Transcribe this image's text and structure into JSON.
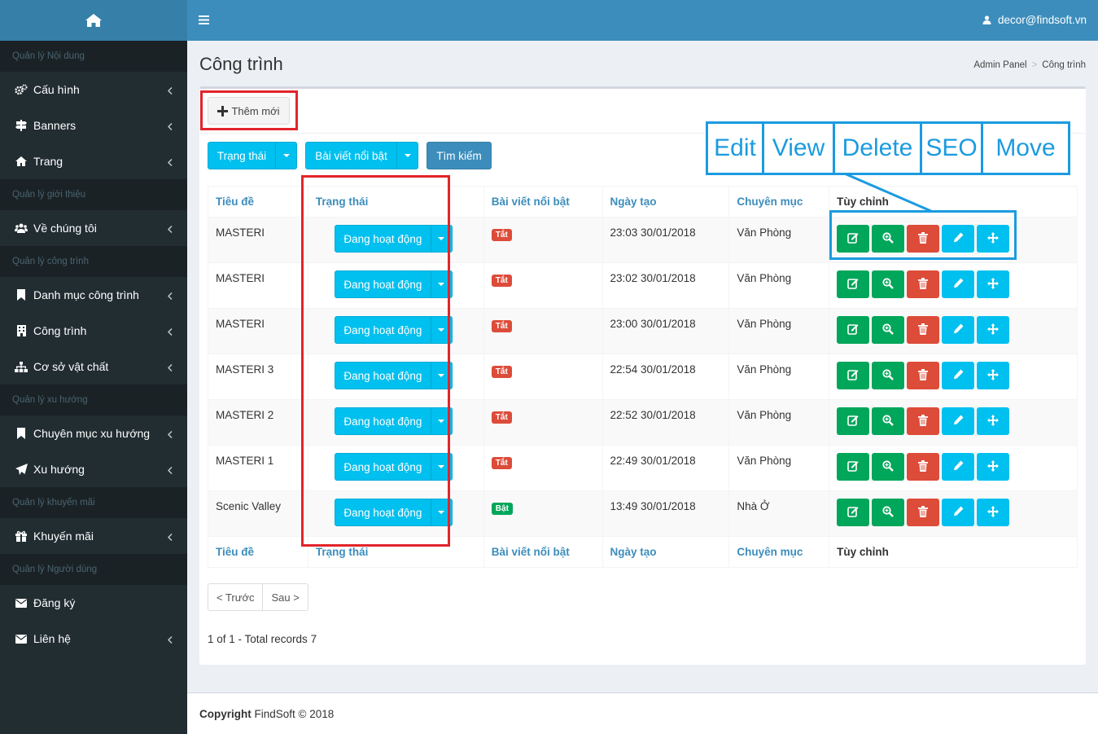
{
  "sidebar": {
    "groups": [
      {
        "title": "Quản lý Nội dung",
        "items": [
          {
            "label": "Cấu hình",
            "icon": "cogs-icon"
          },
          {
            "label": "Banners",
            "icon": "signpost-icon"
          },
          {
            "label": "Trang",
            "icon": "home-icon"
          }
        ]
      },
      {
        "title": "Quản lý giới thiệu",
        "items": [
          {
            "label": "Về chúng tôi",
            "icon": "users-icon"
          }
        ]
      },
      {
        "title": "Quản lý công trình",
        "items": [
          {
            "label": "Danh mục công trình",
            "icon": "bookmark-icon"
          },
          {
            "label": "Công trình",
            "icon": "building-icon"
          },
          {
            "label": "Cơ sở vật chất",
            "icon": "sitemap-icon"
          }
        ]
      },
      {
        "title": "Quản lý xu hướng",
        "items": [
          {
            "label": "Chuyên mục xu hướng",
            "icon": "bookmark-icon"
          },
          {
            "label": "Xu hướng",
            "icon": "paper-plane-icon"
          }
        ]
      },
      {
        "title": "Quản lý khuyến mãi",
        "items": [
          {
            "label": "Khuyến mãi",
            "icon": "gift-icon"
          }
        ]
      },
      {
        "title": "Quản lý Người dùng",
        "items": [
          {
            "label": "Đăng ký",
            "icon": "envelope-icon"
          },
          {
            "label": "Liên hệ",
            "icon": "envelope-icon"
          }
        ]
      }
    ]
  },
  "header": {
    "user": "decor@findsoft.vn"
  },
  "page": {
    "title": "Công trình",
    "breadcrumb": [
      "Admin Panel",
      "Công trình"
    ]
  },
  "toolbar": {
    "add_label": "Thêm mới",
    "status_filter": "Trạng thái",
    "featured_filter": "Bài viết nổi bật",
    "search_label": "Tìm kiếm"
  },
  "table": {
    "headers": [
      "Tiêu đề",
      "Trạng thái",
      "Bài viết nổi bật",
      "Ngày tạo",
      "Chuyên mục",
      "Tùy chỉnh"
    ],
    "rows": [
      {
        "title": "MASTERI",
        "status": "Đang hoạt động",
        "featured": "Tắt",
        "date": "23:03 30/01/2018",
        "category": "Văn Phòng"
      },
      {
        "title": "MASTERI",
        "status": "Đang hoạt động",
        "featured": "Tắt",
        "date": "23:02 30/01/2018",
        "category": "Văn Phòng"
      },
      {
        "title": "MASTERI",
        "status": "Đang hoạt động",
        "featured": "Tắt",
        "date": "23:00 30/01/2018",
        "category": "Văn Phòng"
      },
      {
        "title": "MASTERI 3",
        "status": "Đang hoạt động",
        "featured": "Tắt",
        "date": "22:54 30/01/2018",
        "category": "Văn Phòng"
      },
      {
        "title": "MASTERI 2",
        "status": "Đang hoạt động",
        "featured": "Tắt",
        "date": "22:52 30/01/2018",
        "category": "Văn Phòng"
      },
      {
        "title": "MASTERI 1",
        "status": "Đang hoạt động",
        "featured": "Tắt",
        "date": "22:49 30/01/2018",
        "category": "Văn Phòng"
      },
      {
        "title": "Scenic Valley",
        "status": "Đang hoạt động",
        "featured": "Bật",
        "date": "13:49 30/01/2018",
        "category": "Nhà Ở"
      }
    ]
  },
  "pager": {
    "prev": "< Trước",
    "next": "Sau >",
    "total": "1 of 1 - Total records 7"
  },
  "footer": {
    "bold": "Copyright",
    "rest": " FindSoft © 2018"
  },
  "annotations": [
    "Edit",
    "View",
    "Delete",
    "SEO",
    "Move"
  ],
  "colors": {
    "sidebar": "#222d32",
    "header": "#3c8dbc",
    "success": "#00a65a",
    "danger": "#dd4b39",
    "info": "#00c0ef",
    "highlight_red": "#e2242b",
    "highlight_blue": "#1b9be0"
  }
}
